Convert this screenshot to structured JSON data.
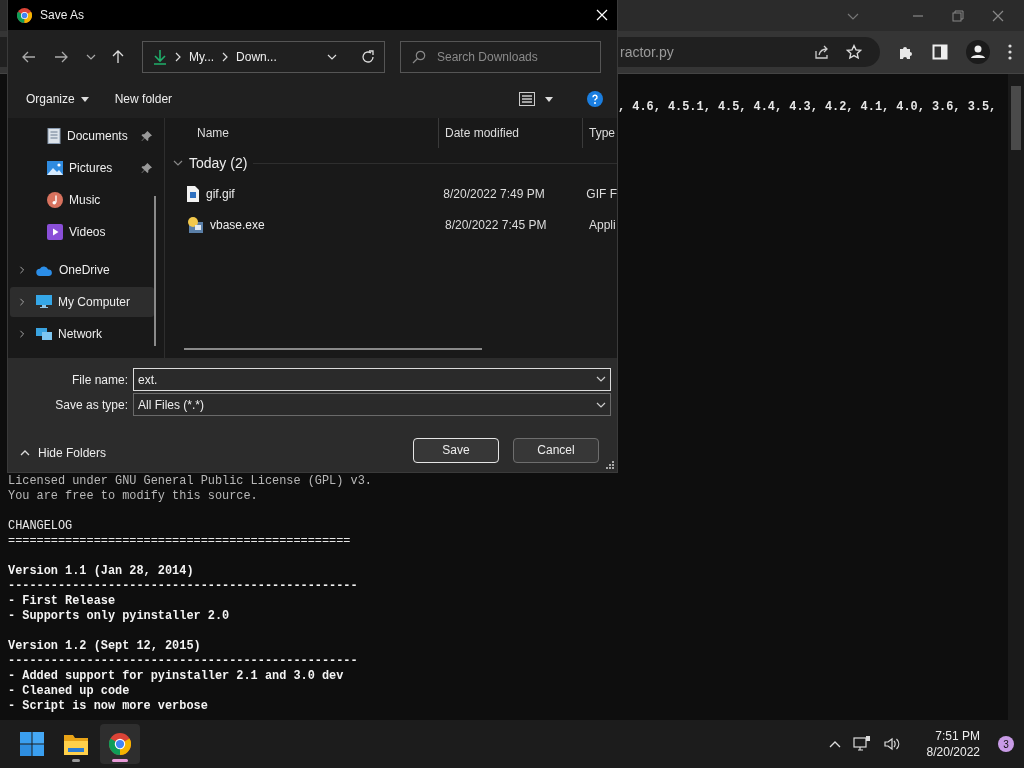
{
  "browser": {
    "address_text": "ractor.py",
    "first_line": ", 4.6, 4.5.1, 4.5, 4.4, 4.3, 4.2, 4.1, 4.0, 3.6, 3.5,",
    "blocks": [
      {
        "lines": [
          {
            "text": "Licensed under GNU General Public License (GPL) v3.",
            "kind": "dim"
          },
          {
            "text": "You are free to modify this source.",
            "kind": "dim"
          }
        ]
      },
      {
        "lines": [
          {
            "text": "CHANGELOG",
            "kind": "plain"
          },
          {
            "text": "================================================",
            "kind": "plain"
          }
        ]
      },
      {
        "lines": [
          {
            "text": "Version 1.1 (Jan 28, 2014)",
            "kind": "bold"
          },
          {
            "text": "-------------------------------------------------",
            "kind": "bold"
          },
          {
            "text": "- First Release",
            "kind": "bold"
          },
          {
            "text": "- Supports only pyinstaller 2.0",
            "kind": "bold"
          }
        ]
      },
      {
        "lines": [
          {
            "text": "Version 1.2 (Sept 12, 2015)",
            "kind": "bold"
          },
          {
            "text": "-------------------------------------------------",
            "kind": "bold"
          },
          {
            "text": "- Added support for pyinstaller 2.1 and 3.0 dev",
            "kind": "bold"
          },
          {
            "text": "- Cleaned up code",
            "kind": "bold"
          },
          {
            "text": "- Script is now more verbose",
            "kind": "bold"
          }
        ]
      }
    ]
  },
  "dialog": {
    "title": "Save As",
    "breadcrumb": [
      "My...",
      "Down..."
    ],
    "search": {
      "placeholder": "Search Downloads"
    },
    "commands": [
      {
        "label": "Organize",
        "dropdown": true
      },
      {
        "label": "New folder",
        "dropdown": false
      }
    ],
    "sidebar": {
      "quick_items": [
        {
          "label": "Documents",
          "pinned": true,
          "selected": false
        },
        {
          "label": "Pictures",
          "pinned": true,
          "selected": false
        },
        {
          "label": "Music",
          "pinned": false,
          "selected": false
        },
        {
          "label": "Videos",
          "pinned": false,
          "selected": false
        }
      ],
      "locations": [
        {
          "label": "OneDrive",
          "expanded": false,
          "selected": false
        },
        {
          "label": "My Computer",
          "expanded": false,
          "selected": true
        },
        {
          "label": "Network",
          "expanded": false,
          "selected": false
        }
      ]
    },
    "columns": [
      "Name",
      "Date modified",
      "Type"
    ],
    "groups": [
      {
        "label": "Today (2)",
        "expanded": true,
        "files": [
          {
            "name": "gif.gif",
            "date_modified": "8/20/2022 7:49 PM",
            "type": "GIF F"
          },
          {
            "name": "vbase.exe",
            "date_modified": "8/20/2022 7:45 PM",
            "type": "Appli"
          }
        ]
      }
    ],
    "file_name": {
      "label": "File name:",
      "value": "ext."
    },
    "save_as_type": {
      "label": "Save as type:",
      "value": "All Files (*.*)"
    },
    "hide_folders": "Hide Folders",
    "buttons": [
      {
        "label": "Save",
        "default": true
      },
      {
        "label": "Cancel",
        "default": false
      }
    ]
  },
  "taskbar": {
    "apps": [
      {
        "running": false,
        "selected": false
      },
      {
        "running": true,
        "selected": false
      },
      {
        "running": true,
        "selected": true
      }
    ],
    "time": "7:51 PM",
    "date": "8/20/2022",
    "notifications": "3"
  }
}
